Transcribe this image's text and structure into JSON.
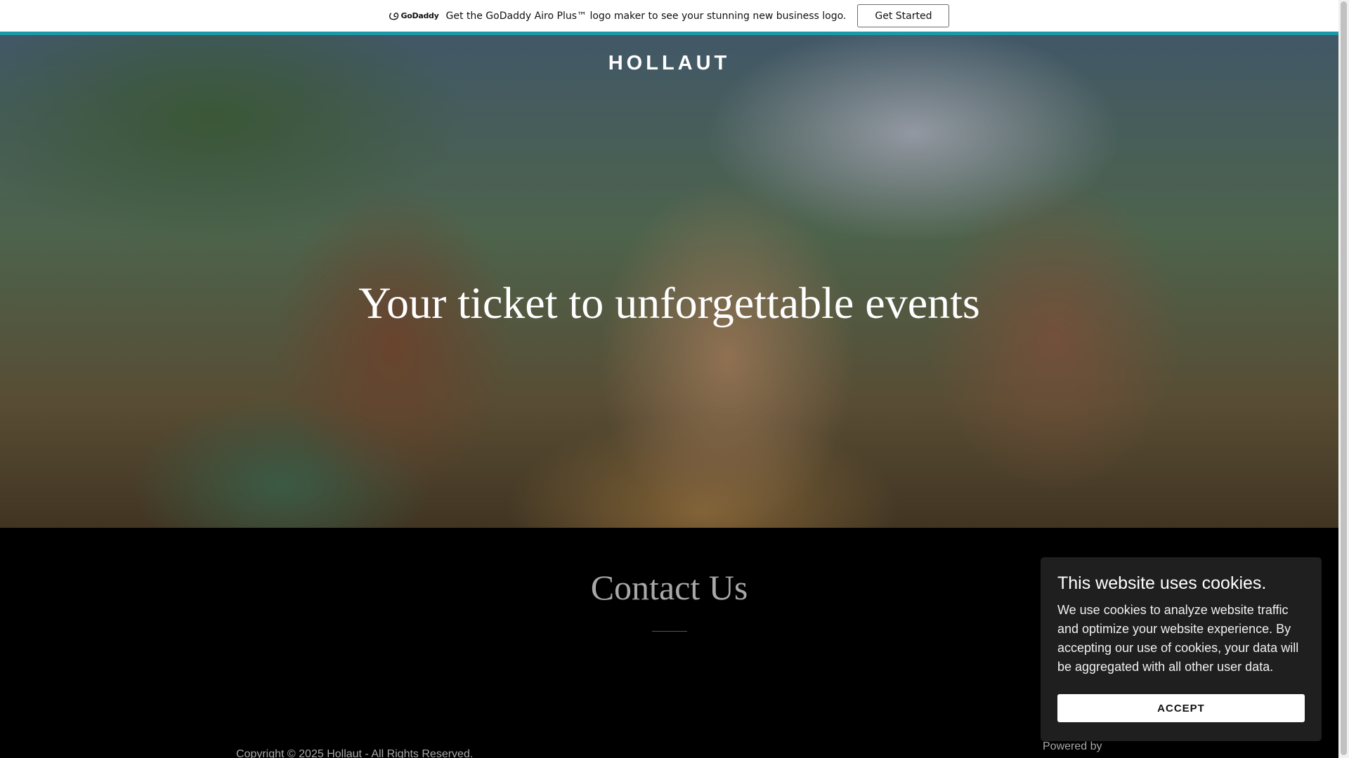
{
  "promo": {
    "brand": "GoDaddy",
    "message": "Get the GoDaddy Airo Plus™ logo maker to see your stunning new business logo.",
    "button_label": "Get Started",
    "accent_color": "#1a9aa8"
  },
  "hero": {
    "brand": "HOLLAUT",
    "title": "Your ticket to unforgettable events"
  },
  "contact": {
    "title": "Contact Us"
  },
  "footer": {
    "copyright": "Copyright © 2025 Hollaut - All Rights Reserved.",
    "powered_by": "Powered by"
  },
  "cookie": {
    "title": "This website uses cookies.",
    "message": "We use cookies to analyze website traffic and optimize your website experience. By accepting our use of cookies, your data will be aggregated with all other user data.",
    "accept_label": "ACCEPT"
  }
}
